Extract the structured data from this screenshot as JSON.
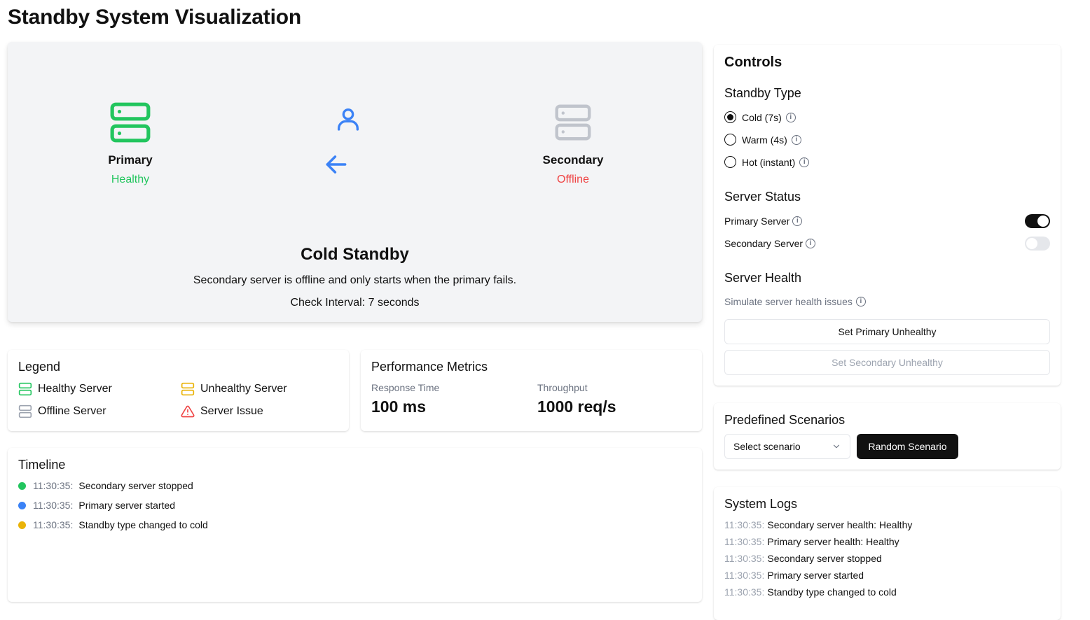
{
  "page": {
    "title": "Standby System Visualization"
  },
  "visualization": {
    "primary": {
      "name": "Primary",
      "status": "Healthy",
      "status_color": "#22c55e"
    },
    "secondary": {
      "name": "Secondary",
      "status": "Offline",
      "status_color": "#ef4444"
    },
    "mode_title": "Cold Standby",
    "mode_description": "Secondary server is offline and only starts when the primary fails.",
    "check_interval": "Check Interval: 7 seconds",
    "colors": {
      "healthy": "#22c55e",
      "offline": "#9ca3af",
      "accent": "#3b82f6",
      "unhealthy": "#eab308",
      "issue": "#ef4444"
    }
  },
  "legend": {
    "title": "Legend",
    "items": [
      "Healthy Server",
      "Unhealthy Server",
      "Offline Server",
      "Server Issue"
    ]
  },
  "metrics": {
    "title": "Performance Metrics",
    "response_time_label": "Response Time",
    "response_time_value": "100 ms",
    "throughput_label": "Throughput",
    "throughput_value": "1000 req/s"
  },
  "timeline": {
    "title": "Timeline",
    "events": [
      {
        "time": "11:30:35:",
        "text": "Secondary server stopped",
        "color": "#22c55e"
      },
      {
        "time": "11:30:35:",
        "text": "Primary server started",
        "color": "#3b82f6"
      },
      {
        "time": "11:30:35:",
        "text": "Standby type changed to cold",
        "color": "#eab308"
      }
    ]
  },
  "controls": {
    "title": "Controls",
    "standby_type_label": "Standby Type",
    "standby_options": [
      "Cold (7s)",
      "Warm (4s)",
      "Hot (instant)"
    ],
    "selected_standby": "Cold (7s)",
    "server_status_label": "Server Status",
    "primary_server_label": "Primary Server",
    "primary_server_on": true,
    "secondary_server_label": "Secondary Server",
    "secondary_server_on": false,
    "server_health_label": "Server Health",
    "simulate_label": "Simulate server health issues",
    "set_primary_unhealthy": "Set Primary Unhealthy",
    "set_secondary_unhealthy": "Set Secondary Unhealthy"
  },
  "scenarios": {
    "title": "Predefined Scenarios",
    "select_value": "Select scenario",
    "random_button": "Random Scenario"
  },
  "logs": {
    "title": "System Logs",
    "entries": [
      {
        "time": "11:30:35:",
        "text": "Secondary server health: Healthy"
      },
      {
        "time": "11:30:35:",
        "text": "Primary server health: Healthy"
      },
      {
        "time": "11:30:35:",
        "text": "Secondary server stopped"
      },
      {
        "time": "11:30:35:",
        "text": "Primary server started"
      },
      {
        "time": "11:30:35:",
        "text": "Standby type changed to cold"
      }
    ]
  }
}
